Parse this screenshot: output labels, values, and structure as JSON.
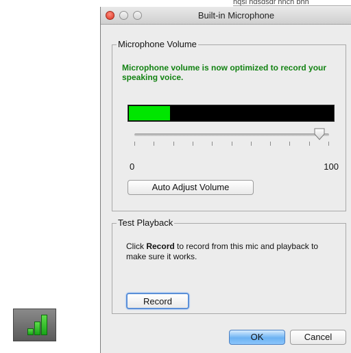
{
  "window": {
    "title": "Built-in Microphone"
  },
  "behind_window": {
    "clipped_text": "hqsl hdsdsdr hnch bhh"
  },
  "microphone_volume": {
    "legend": "Microphone Volume",
    "message": "Microphone volume is now optimized to record your speaking voice.",
    "input_level": 0.2,
    "meter_colors": {
      "level": "#00e600",
      "background": "#000000"
    },
    "slider": {
      "value": 95,
      "min_label": "0",
      "max_label": "100",
      "tick_count": 11
    },
    "auto_adjust_label": "Auto Adjust Volume"
  },
  "test_playback": {
    "legend": "Test Playback",
    "text_prefix": "Click ",
    "text_bold": "Record",
    "text_suffix": " to record from this mic and playback to make sure it works.",
    "record_label": "Record"
  },
  "footer": {
    "ok_label": "OK",
    "cancel_label": "Cancel"
  },
  "icons": {
    "signal": "signal-bars-icon",
    "accent": "#17a517"
  }
}
